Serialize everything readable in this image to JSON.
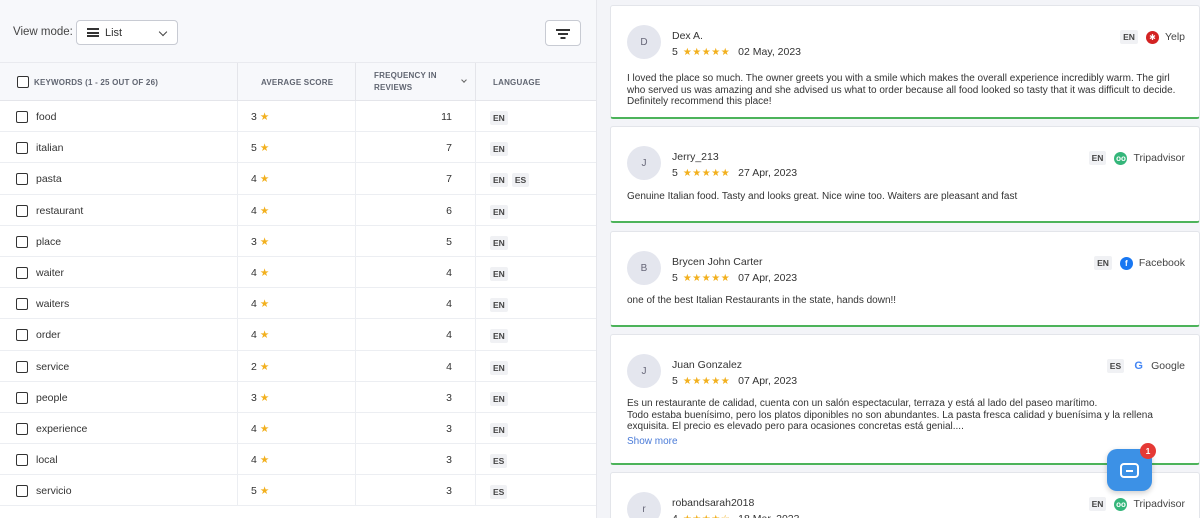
{
  "toolbar": {
    "view_mode_label": "View mode:",
    "view_mode_value": "List"
  },
  "table": {
    "headers": {
      "keywords": "KEYWORDS (1 - 25 OUT OF 26)",
      "average_score": "AVERAGE SCORE",
      "frequency_line1": "FREQUENCY IN",
      "frequency_line2": "REVIEWS",
      "language": "LANGUAGE"
    },
    "rows": [
      {
        "keyword": "food",
        "score": "3",
        "frequency": "11",
        "languages": [
          "EN"
        ]
      },
      {
        "keyword": "italian",
        "score": "5",
        "frequency": "7",
        "languages": [
          "EN"
        ]
      },
      {
        "keyword": "pasta",
        "score": "4",
        "frequency": "7",
        "languages": [
          "EN",
          "ES"
        ]
      },
      {
        "keyword": "restaurant",
        "score": "4",
        "frequency": "6",
        "languages": [
          "EN"
        ]
      },
      {
        "keyword": "place",
        "score": "3",
        "frequency": "5",
        "languages": [
          "EN"
        ]
      },
      {
        "keyword": "waiter",
        "score": "4",
        "frequency": "4",
        "languages": [
          "EN"
        ]
      },
      {
        "keyword": "waiters",
        "score": "4",
        "frequency": "4",
        "languages": [
          "EN"
        ]
      },
      {
        "keyword": "order",
        "score": "4",
        "frequency": "4",
        "languages": [
          "EN"
        ]
      },
      {
        "keyword": "service",
        "score": "2",
        "frequency": "4",
        "languages": [
          "EN"
        ]
      },
      {
        "keyword": "people",
        "score": "3",
        "frequency": "3",
        "languages": [
          "EN"
        ]
      },
      {
        "keyword": "experience",
        "score": "4",
        "frequency": "3",
        "languages": [
          "EN"
        ]
      },
      {
        "keyword": "local",
        "score": "4",
        "frequency": "3",
        "languages": [
          "ES"
        ]
      },
      {
        "keyword": "servicio",
        "score": "5",
        "frequency": "3",
        "languages": [
          "ES"
        ]
      }
    ]
  },
  "reviews": [
    {
      "initial": "D",
      "name": "Dex A.",
      "rating": "5",
      "stars": 5,
      "date": "02 May, 2023",
      "lang": "EN",
      "source": "Yelp",
      "icon": "yelp-icon",
      "text": "I loved the place so much. The owner greets you with a smile which makes the overall experience incredibly warm. The girl who served us was amazing and she advised us what to order because all food looked so tasty that it was difficult to decide. Definitely recommend this place!"
    },
    {
      "initial": "J",
      "name": "Jerry_213",
      "rating": "5",
      "stars": 5,
      "date": "27 Apr, 2023",
      "lang": "EN",
      "source": "Tripadvisor",
      "icon": "tripadvisor-icon",
      "text": "Genuine Italian food. Tasty and looks great. Nice wine too. Waiters are pleasant and fast"
    },
    {
      "initial": "B",
      "name": "Brycen John Carter",
      "rating": "5",
      "stars": 5,
      "date": "07 Apr, 2023",
      "lang": "EN",
      "source": "Facebook",
      "icon": "facebook-icon",
      "text": "one of the best Italian Restaurants in the state, hands down!!"
    },
    {
      "initial": "J",
      "name": "Juan Gonzalez",
      "rating": "5",
      "stars": 5,
      "date": "07 Apr, 2023",
      "lang": "ES",
      "source": "Google",
      "icon": "google-icon",
      "text": "Es un restaurante de calidad, cuenta con un salón espectacular, terraza y está al lado del paseo marítimo.\nTodo estaba buenísimo, pero los platos diponibles no son abundantes. La pasta fresca calidad y buenísima y la rellena exquisita. El precio es elevado pero para ocasiones concretas está genial....",
      "more": "Show more"
    },
    {
      "initial": "r",
      "name": "robandsarah2018",
      "rating": "4",
      "stars": 4,
      "date": "18 Mar, 2023",
      "lang": "EN",
      "source": "Tripadvisor",
      "icon": "tripadvisor-icon",
      "text": ""
    }
  ],
  "chat": {
    "badge_count": "1"
  },
  "colors": {
    "star": "#f2b01e",
    "accent_green": "#4cb35a",
    "chat_blue": "#3c91e6",
    "link": "#4a7bd8"
  }
}
